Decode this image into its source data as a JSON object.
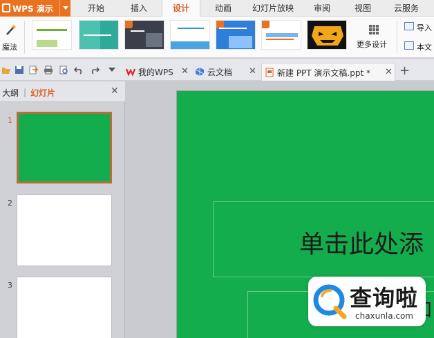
{
  "app": {
    "title": "WPS 演示"
  },
  "menu": {
    "tabs": [
      "开始",
      "插入",
      "设计",
      "动画",
      "幻灯片放映",
      "审阅",
      "视图",
      "云服务"
    ],
    "active": "设计"
  },
  "ribbon": {
    "magic_label": "魔法",
    "more_design_label": "更多设计",
    "right_buttons": [
      "导入",
      "本文"
    ],
    "template_count": 8
  },
  "doc_tabs": [
    {
      "label": "我的WPS",
      "icon": "wps-logo-icon"
    },
    {
      "label": "云文档",
      "icon": "cloud-doc-icon"
    },
    {
      "label": "新建 PPT 演示文稿.ppt *",
      "icon": "ppt-file-icon",
      "active": true
    }
  ],
  "panel": {
    "tab_outline": "大纲",
    "tab_slides": "幻灯片",
    "slide_numbers": [
      "1",
      "2",
      "3"
    ]
  },
  "slide": {
    "title_placeholder": "单击此处添",
    "subtitle_placeholder": "加",
    "background_color": "#13ad4d"
  },
  "watermark": {
    "brand": "查询啦",
    "domain": "chaxunla.com"
  },
  "colors": {
    "accent": "#e8721f",
    "active_tab": "#d9622b",
    "slide_green": "#13ad4d"
  }
}
